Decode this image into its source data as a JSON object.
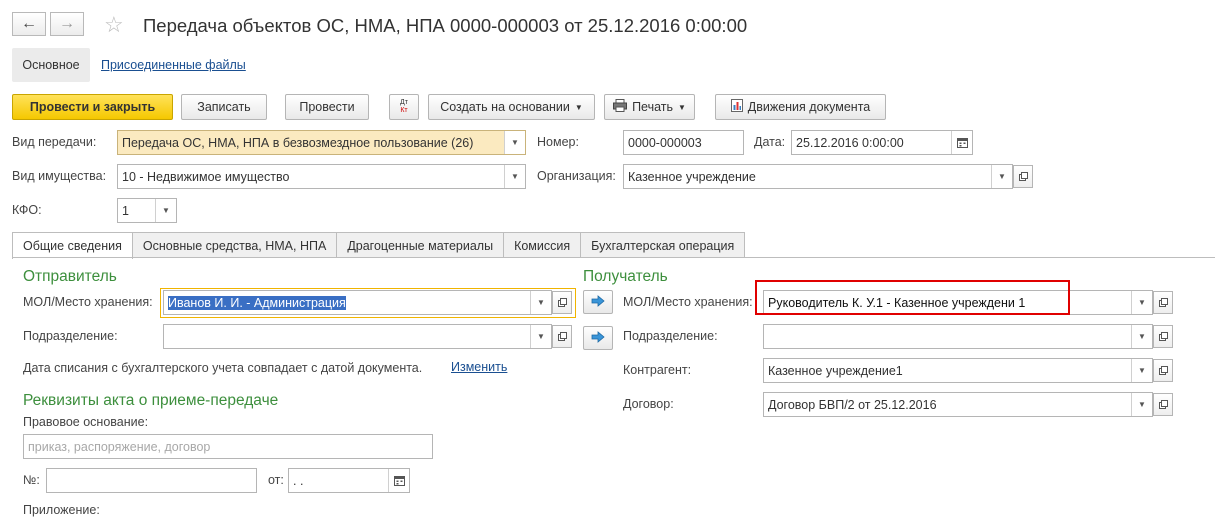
{
  "window": {
    "title": "Передача объектов ОС, НМА, НПА 0000-000003 от 25.12.2016 0:00:00",
    "back_icon": "←",
    "forward_icon": "→",
    "star_icon": "☆"
  },
  "top_tabs": {
    "main": "Основное",
    "files": "Присоединенные файлы"
  },
  "toolbar": {
    "post_close": "Провести и закрыть",
    "save": "Записать",
    "post": "Провести",
    "dt_kt_top": "Дт",
    "dt_kt_bottom": "Кт",
    "create_based": "Создать на основании",
    "print": "Печать",
    "movements": "Движения документа"
  },
  "header": {
    "transfer_type_label": "Вид передачи:",
    "transfer_type_value": "Передача ОС, НМА, НПА в безвозмездное пользование (26)",
    "number_label": "Номер:",
    "number_value": "0000-000003",
    "date_label": "Дата:",
    "date_value": "25.12.2016  0:00:00",
    "property_type_label": "Вид имущества:",
    "property_type_value": "10 - Недвижимое имущество",
    "org_label": "Организация:",
    "org_value": "Казенное учреждение",
    "kfo_label": "КФО:",
    "kfo_value": "1"
  },
  "tabs": [
    "Общие сведения",
    "Основные средства, НМА, НПА",
    "Драгоценные материалы",
    "Комиссия",
    "Бухгалтерская операция"
  ],
  "sender": {
    "title": "Отправитель",
    "mol_label": "МОЛ/Место хранения:",
    "mol_value": "Иванов И. И. - Администрация",
    "dept_label": "Подразделение:",
    "dept_value": "",
    "writeoff_note": "Дата списания с бухгалтерского учета совпадает с датой документа.",
    "change_link": "Изменить"
  },
  "recipient": {
    "title": "Получатель",
    "mol_label": "МОЛ/Место хранения:",
    "mol_value": "Руководитель К. У.1 - Казенное учреждени 1",
    "dept_label": "Подразделение:",
    "dept_value": "",
    "contractor_label": "Контрагент:",
    "contractor_value": "Казенное учреждение1",
    "contract_label": "Договор:",
    "contract_value": "Договор БВП/2 от 25.12.2016"
  },
  "act": {
    "title": "Реквизиты акта о приеме-передаче",
    "basis_label": "Правовое основание:",
    "basis_placeholder": "приказ, распоряжение, договор",
    "num_label": "№:",
    "num_value": "",
    "from_label": "от:",
    "from_value": "  .  .",
    "attachment_label": "Приложение:"
  },
  "colors": {
    "accent_yellow": "#f5c800",
    "section_green": "#3d8f3d",
    "highlight_red": "#e00000",
    "selection_blue": "#3a6fc4",
    "focus_orange": "#f0b400"
  }
}
